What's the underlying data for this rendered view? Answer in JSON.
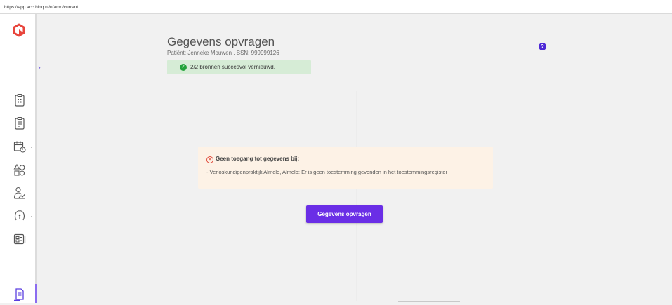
{
  "browser": {
    "url": "https://app.acc.hinq.nl/n/amo/current"
  },
  "colors": {
    "brand_logo": "#e8453c",
    "accent": "#6a2ee6",
    "success_bg": "#d6ecd6",
    "success_icon": "#22a23a",
    "warning_bg": "#fdf2e6",
    "error_icon": "#e04a3a",
    "help_icon": "#4d28d6"
  },
  "sidebar": {
    "items": [
      {
        "icon": "clipboard-chart-icon"
      },
      {
        "icon": "clipboard-list-icon"
      },
      {
        "icon": "calendar-clock-icon"
      },
      {
        "icon": "shapes-icon"
      },
      {
        "icon": "user-chart-icon"
      },
      {
        "icon": "pregnancy-icon"
      },
      {
        "icon": "id-card-icon"
      },
      {
        "icon": "document-edit-icon"
      }
    ]
  },
  "header": {
    "title": "Gegevens opvragen",
    "patient_label": "Patiënt: Jenneke Mouwen , BSN: 999999126"
  },
  "success": {
    "message": "2/2 bronnen succesvol vernieuwd."
  },
  "warning": {
    "title": "Geen toegang tot gegevens bij:",
    "lines": [
      "- Verloskundigenpraktijk Almelo, Almelo: Er is geen toestemming gevonden in het toestemmingsregister"
    ]
  },
  "actions": {
    "request_label": "Gegevens opvragen"
  },
  "help": {
    "glyph": "?"
  }
}
